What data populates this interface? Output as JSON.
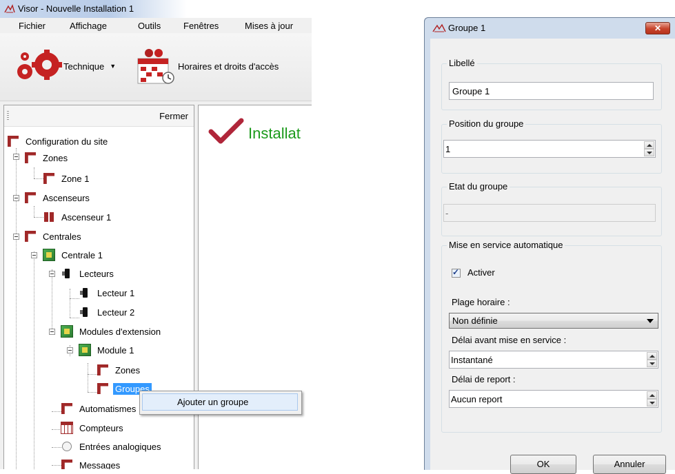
{
  "app": {
    "window_title": "Visor - Nouvelle Installation 1",
    "menu": [
      "Fichier",
      "Affichage",
      "Outils",
      "Fenêtres",
      "Mises à jour"
    ],
    "toolbar": {
      "technique_label": "Technique",
      "horaires_label": "Horaires et droits d'accès"
    },
    "tree_panel": {
      "close_label": "Fermer"
    },
    "tree": [
      {
        "label": "Configuration du site",
        "icon": "red-flag-icon"
      },
      {
        "label": "Zones",
        "icon": "red-flag-icon"
      },
      {
        "label": "Zone 1",
        "icon": "red-flag-icon"
      },
      {
        "label": "Ascenseurs",
        "icon": "red-flag-icon"
      },
      {
        "label": "Ascenseur 1",
        "icon": "elevator-icon"
      },
      {
        "label": "Centrales",
        "icon": "red-flag-icon"
      },
      {
        "label": "Centrale 1",
        "icon": "circuit-board-icon"
      },
      {
        "label": "Lecteurs",
        "icon": "card-reader-icon"
      },
      {
        "label": "Lecteur 1",
        "icon": "card-reader-icon"
      },
      {
        "label": "Lecteur 2",
        "icon": "card-reader-icon"
      },
      {
        "label": "Modules d'extension",
        "icon": "circuit-board-icon"
      },
      {
        "label": "Module 1",
        "icon": "circuit-board-icon"
      },
      {
        "label": "Zones",
        "icon": "red-flag-icon"
      },
      {
        "label": "Groupes",
        "icon": "red-flag-icon"
      },
      {
        "label": "Automatismes",
        "icon": "red-flag-icon"
      },
      {
        "label": "Compteurs",
        "icon": "counter-grid-icon"
      },
      {
        "label": "Entrées analogiques",
        "icon": "gauge-icon"
      },
      {
        "label": "Messages",
        "icon": "red-flag-icon"
      }
    ],
    "content": {
      "heading": "Installat"
    },
    "context_menu": {
      "add_group": "Ajouter un groupe"
    }
  },
  "dialog": {
    "title": "Groupe 1",
    "libelle": {
      "legend": "Libellé",
      "value": "Groupe 1"
    },
    "position": {
      "legend": "Position du groupe",
      "value": "1"
    },
    "etat": {
      "legend": "Etat du groupe",
      "value": "-"
    },
    "auto": {
      "legend": "Mise en service automatique",
      "activer_label": "Activer",
      "activer_checked": true,
      "plage_label": "Plage horaire :",
      "plage_value": "Non définie",
      "delai_label": "Délai avant mise en service :",
      "delai_value": "Instantané",
      "report_label": "Délai de report :",
      "report_value": "Aucun report"
    },
    "ok_label": "OK",
    "cancel_label": "Annuler"
  },
  "colors": {
    "selection": "#3399ff",
    "install_green": "#1a9a1a",
    "brand_red": "#a02828"
  }
}
